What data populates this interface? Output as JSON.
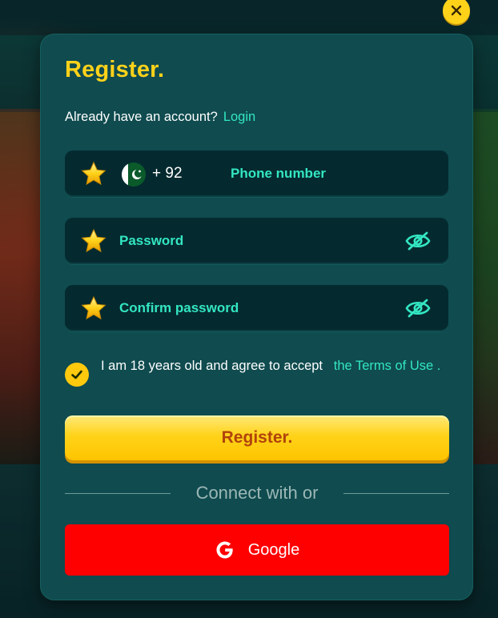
{
  "modal": {
    "title": "Register.",
    "have_account_text": "Already have an account?",
    "login_link": "Login"
  },
  "phone_field": {
    "required_icon": "star-icon",
    "flag_icon": "pakistan-flag-icon",
    "dial_code": "+ 92",
    "placeholder": "Phone number"
  },
  "password_field": {
    "required_icon": "star-icon",
    "placeholder": "Password",
    "toggle_icon": "eye-slash-icon"
  },
  "confirm_field": {
    "required_icon": "star-icon",
    "placeholder": "Confirm password",
    "toggle_icon": "eye-slash-icon"
  },
  "agreement": {
    "checked": true,
    "text": "I am 18 years old and agree to accept",
    "terms_link": "the Terms of Use",
    "suffix": "."
  },
  "register_button": "Register.",
  "connect_text": "Connect with or",
  "google_button": {
    "icon": "google-icon",
    "label": "Google"
  },
  "close_icon": "close-icon",
  "colors": {
    "accent_yellow": "#ffd21a",
    "accent_cyan": "#33e6c2",
    "modal_bg": "#0f4b4f",
    "field_bg": "#042a2f",
    "register_text": "#b1430c",
    "google_red": "#ff0000"
  }
}
